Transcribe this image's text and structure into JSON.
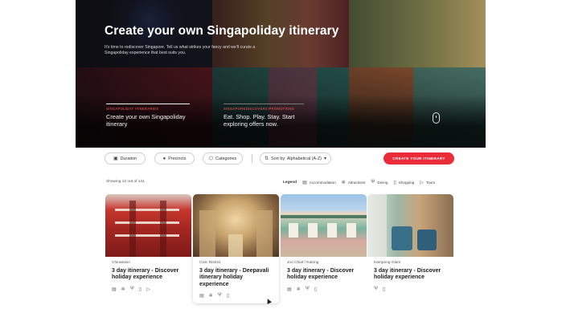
{
  "hero": {
    "title": "Create your own Singapoliday itinerary",
    "description": "It's time to rediscover Singapore. Tell us what strikes your fancy and we'll curate a Singapoliday experience that best suits you.",
    "promos": [
      {
        "kicker": "Singapoliday itineraries",
        "title": "Create your own Singapoliday itinerary"
      },
      {
        "kicker": "SingapoRediscovers promotions",
        "title": "Eat. Shop. Play. Stay. Start exploring offers now."
      }
    ]
  },
  "filters": {
    "duration": "Duration",
    "precincts": "Precincts",
    "categories": "Categories",
    "sort": "Sort by: Alphabetical (A-Z)",
    "cta": "CREATE YOUR ITINERARY"
  },
  "results": {
    "showing": "Showing 12 out of 141"
  },
  "legend": {
    "title": "Legend",
    "items": [
      {
        "label": "Accommodation",
        "icon": "bed-icon"
      },
      {
        "label": "Attractions",
        "icon": "attraction-icon"
      },
      {
        "label": "Dining",
        "icon": "dining-icon"
      },
      {
        "label": "Shopping",
        "icon": "shopping-icon"
      },
      {
        "label": "Tours",
        "icon": "tours-icon"
      }
    ]
  },
  "cards": [
    {
      "district": "Chinatown",
      "title": "3 day itinerary - Discover holiday experience"
    },
    {
      "district": "Civic District",
      "title": "3 day itinerary - Deepavali itinerary holiday experience"
    },
    {
      "district": "Joo Chiat / Katong",
      "title": "3 day itinerary - Discover holiday experience"
    },
    {
      "district": "Kampong Glam",
      "title": "3 day itinerary - Discover holiday experience"
    }
  ]
}
